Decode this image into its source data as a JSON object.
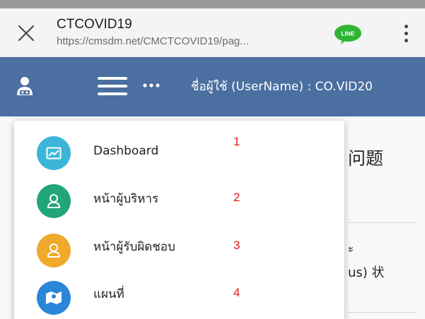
{
  "browser": {
    "title": "CTCOVID19",
    "url": "https://cmsdm.net/CMCTCOVID19/pag...",
    "line_badge": "LINE"
  },
  "header": {
    "username_text": "ชื่อผู้ใช้ (UserName) : CO.VID20",
    "color": "#4a6fa0"
  },
  "background_text": {
    "heading_fragment": "问题",
    "line1_fragment": "ะ",
    "line2_fragment": "us) 状"
  },
  "menu": {
    "items": [
      {
        "label": "Dashboard",
        "number": "1",
        "icon": "chart-icon",
        "color": "#3cb6d8"
      },
      {
        "label": "หน้าผู้บริหาร",
        "number": "2",
        "icon": "person-icon",
        "color": "#21a57a"
      },
      {
        "label": "หน้าผู้รับผิดชอบ",
        "number": "3",
        "icon": "person-icon",
        "color": "#f0a92b"
      },
      {
        "label": "แผนที่",
        "number": "4",
        "icon": "map-icon",
        "color": "#2a86d8"
      }
    ]
  }
}
